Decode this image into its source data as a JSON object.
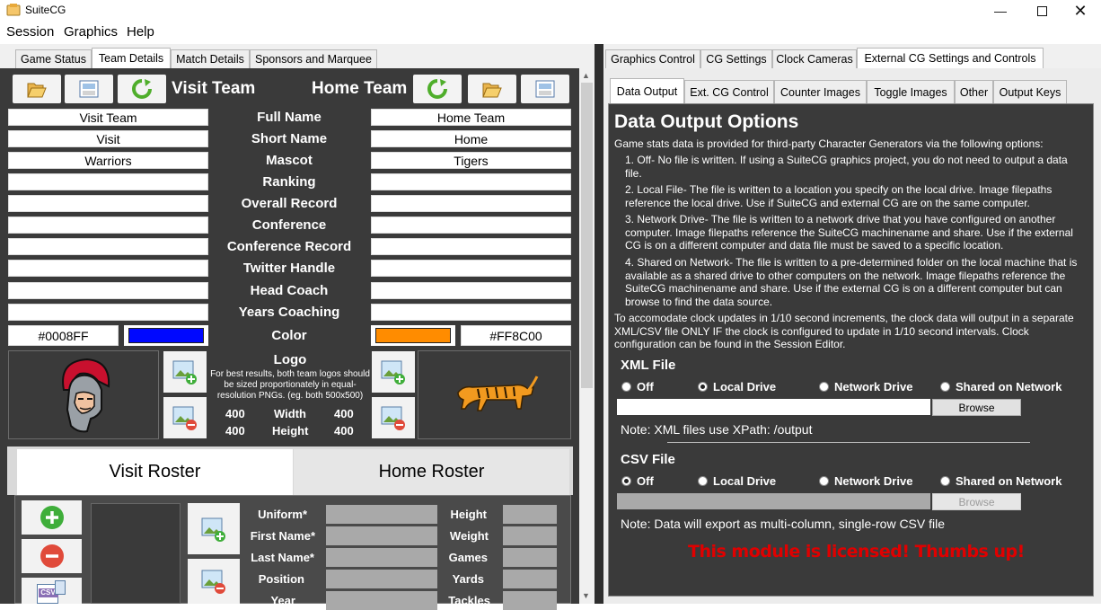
{
  "app": {
    "title": "SuiteCG",
    "window_controls": [
      "minimize",
      "maximize",
      "close"
    ]
  },
  "menu": [
    "Session",
    "Graphics",
    "Help"
  ],
  "left_tabs": [
    "Game Status",
    "Team Details",
    "Match Details",
    "Sponsors and Marquee"
  ],
  "right_tabs": [
    "Graphics Control",
    "CG Settings",
    "Clock Cameras",
    "External CG Settings and Controls"
  ],
  "sub_tabs": [
    "Data Output",
    "Ext. CG Control",
    "Counter Images",
    "Toggle Images",
    "Other",
    "Output Keys"
  ],
  "team": {
    "visit_title": "Visit Team",
    "home_title": "Home Team",
    "fields": [
      {
        "label": "Full Name",
        "visit": "Visit Team",
        "home": "Home Team"
      },
      {
        "label": "Short Name",
        "visit": "Visit",
        "home": "Home"
      },
      {
        "label": "Mascot",
        "visit": "Warriors",
        "home": "Tigers"
      },
      {
        "label": "Ranking",
        "visit": "",
        "home": ""
      },
      {
        "label": "Overall Record",
        "visit": "",
        "home": ""
      },
      {
        "label": "Conference",
        "visit": "",
        "home": ""
      },
      {
        "label": "Conference Record",
        "visit": "",
        "home": ""
      },
      {
        "label": "Twitter Handle",
        "visit": "",
        "home": ""
      },
      {
        "label": "Head Coach",
        "visit": "",
        "home": ""
      },
      {
        "label": "Years Coaching",
        "visit": "",
        "home": ""
      }
    ],
    "color_label": "Color",
    "visit_color": "#0008FF",
    "home_color": "#FF8C00",
    "logo_label": "Logo",
    "logo_note": "For best results, both team logos should be sized proportionately in equal-resolution PNGs. (eg. both 500x500)",
    "width_label": "Width",
    "height_label": "Height",
    "visit_width": "400",
    "visit_height": "400",
    "home_width": "400",
    "home_height": "400"
  },
  "roster": {
    "visit_tab": "Visit Roster",
    "home_tab": "Home Roster",
    "left_labels": [
      "Uniform*",
      "First Name*",
      "Last Name*",
      "Position",
      "Year"
    ],
    "right_labels": [
      "Height",
      "Weight",
      "Games",
      "Yards",
      "Tackles"
    ],
    "csv_icon_text": "CSV"
  },
  "data_output": {
    "heading": "Data Output Options",
    "intro": "Game stats data is provided for third-party Character Generators via the following options:",
    "options": [
      "1. Off- No file is written. If using a SuiteCG graphics project, you do not need to output a data file.",
      "2. Local File- The file is written to a location you specify on the local drive. Image filepaths reference the local drive. Use if SuiteCG and external CG are on the same computer.",
      "3. Network Drive- The file is written to a network drive that you have configured on another computer. Image filepaths reference the SuiteCG machinename and share. Use if the external CG is on a different computer and data file must be saved to a specific location.",
      "4. Shared on Network- The file is written to a pre-determined folder on the local machine that is available as a shared drive to other computers on the network. Image filepaths reference the SuiteCG machinename and share. Use if the external CG is on a different computer but can browse to find the data source."
    ],
    "clock_note": "To accomodate clock updates in 1/10 second increments, the clock data will output in a separate XML/CSV file ONLY IF the clock is configured to update in 1/10 second intervals. Clock configuration can be found in the Session Editor.",
    "xml": {
      "title": "XML File",
      "options": [
        "Off",
        "Local Drive",
        "Network Drive",
        "Shared on Network"
      ],
      "selected": "Local Drive",
      "path": "",
      "browse": "Browse",
      "note": "Note: XML files use XPath: /output"
    },
    "csv": {
      "title": "CSV File",
      "options": [
        "Off",
        "Local Drive",
        "Network Drive",
        "Shared on Network"
      ],
      "selected": "Off",
      "path": "",
      "browse": "Browse",
      "note": "Note: Data will export as multi-column, single-row CSV file"
    },
    "license": "This module is licensed! Thumbs up!",
    "license_color": "#E00000"
  }
}
